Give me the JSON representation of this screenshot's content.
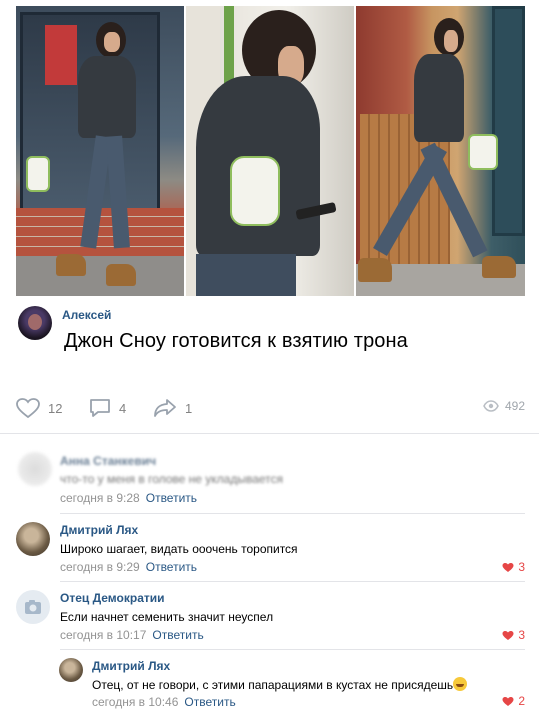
{
  "post": {
    "author": "Алексей",
    "text": "Джон Сноу готовится к взятию трона",
    "likes": "12",
    "comments": "4",
    "shares": "1",
    "views": "492"
  },
  "comments": [
    {
      "name": "Анна Станкевич",
      "text": "что-то у меня в голове не укладывается",
      "date": "сегодня в 9:28",
      "reply": "Ответить"
    },
    {
      "name": "Дмитрий Лях",
      "text": "Широко шагает, видать ооочень торопится",
      "date": "сегодня в 9:29",
      "reply": "Ответить",
      "likes": "3"
    },
    {
      "name": "Отец Демократии",
      "text": "Если начнет семенить значит неуспел",
      "date": "сегодня в 10:17",
      "reply": "Ответить",
      "likes": "3"
    },
    {
      "name": "Дмитрий Лях",
      "text": "Отец, от не говори, с этими папарациями в кустах не присядешь",
      "date": "сегодня в 10:46",
      "reply": "Ответить",
      "likes": "2"
    }
  ],
  "colors": {
    "link": "#2a5885",
    "meta": "#939393",
    "like_active": "#e64646",
    "divider": "#e3e4e8"
  },
  "icons": [
    "heart-icon",
    "comment-icon",
    "share-icon",
    "eye-icon",
    "camera-icon"
  ]
}
